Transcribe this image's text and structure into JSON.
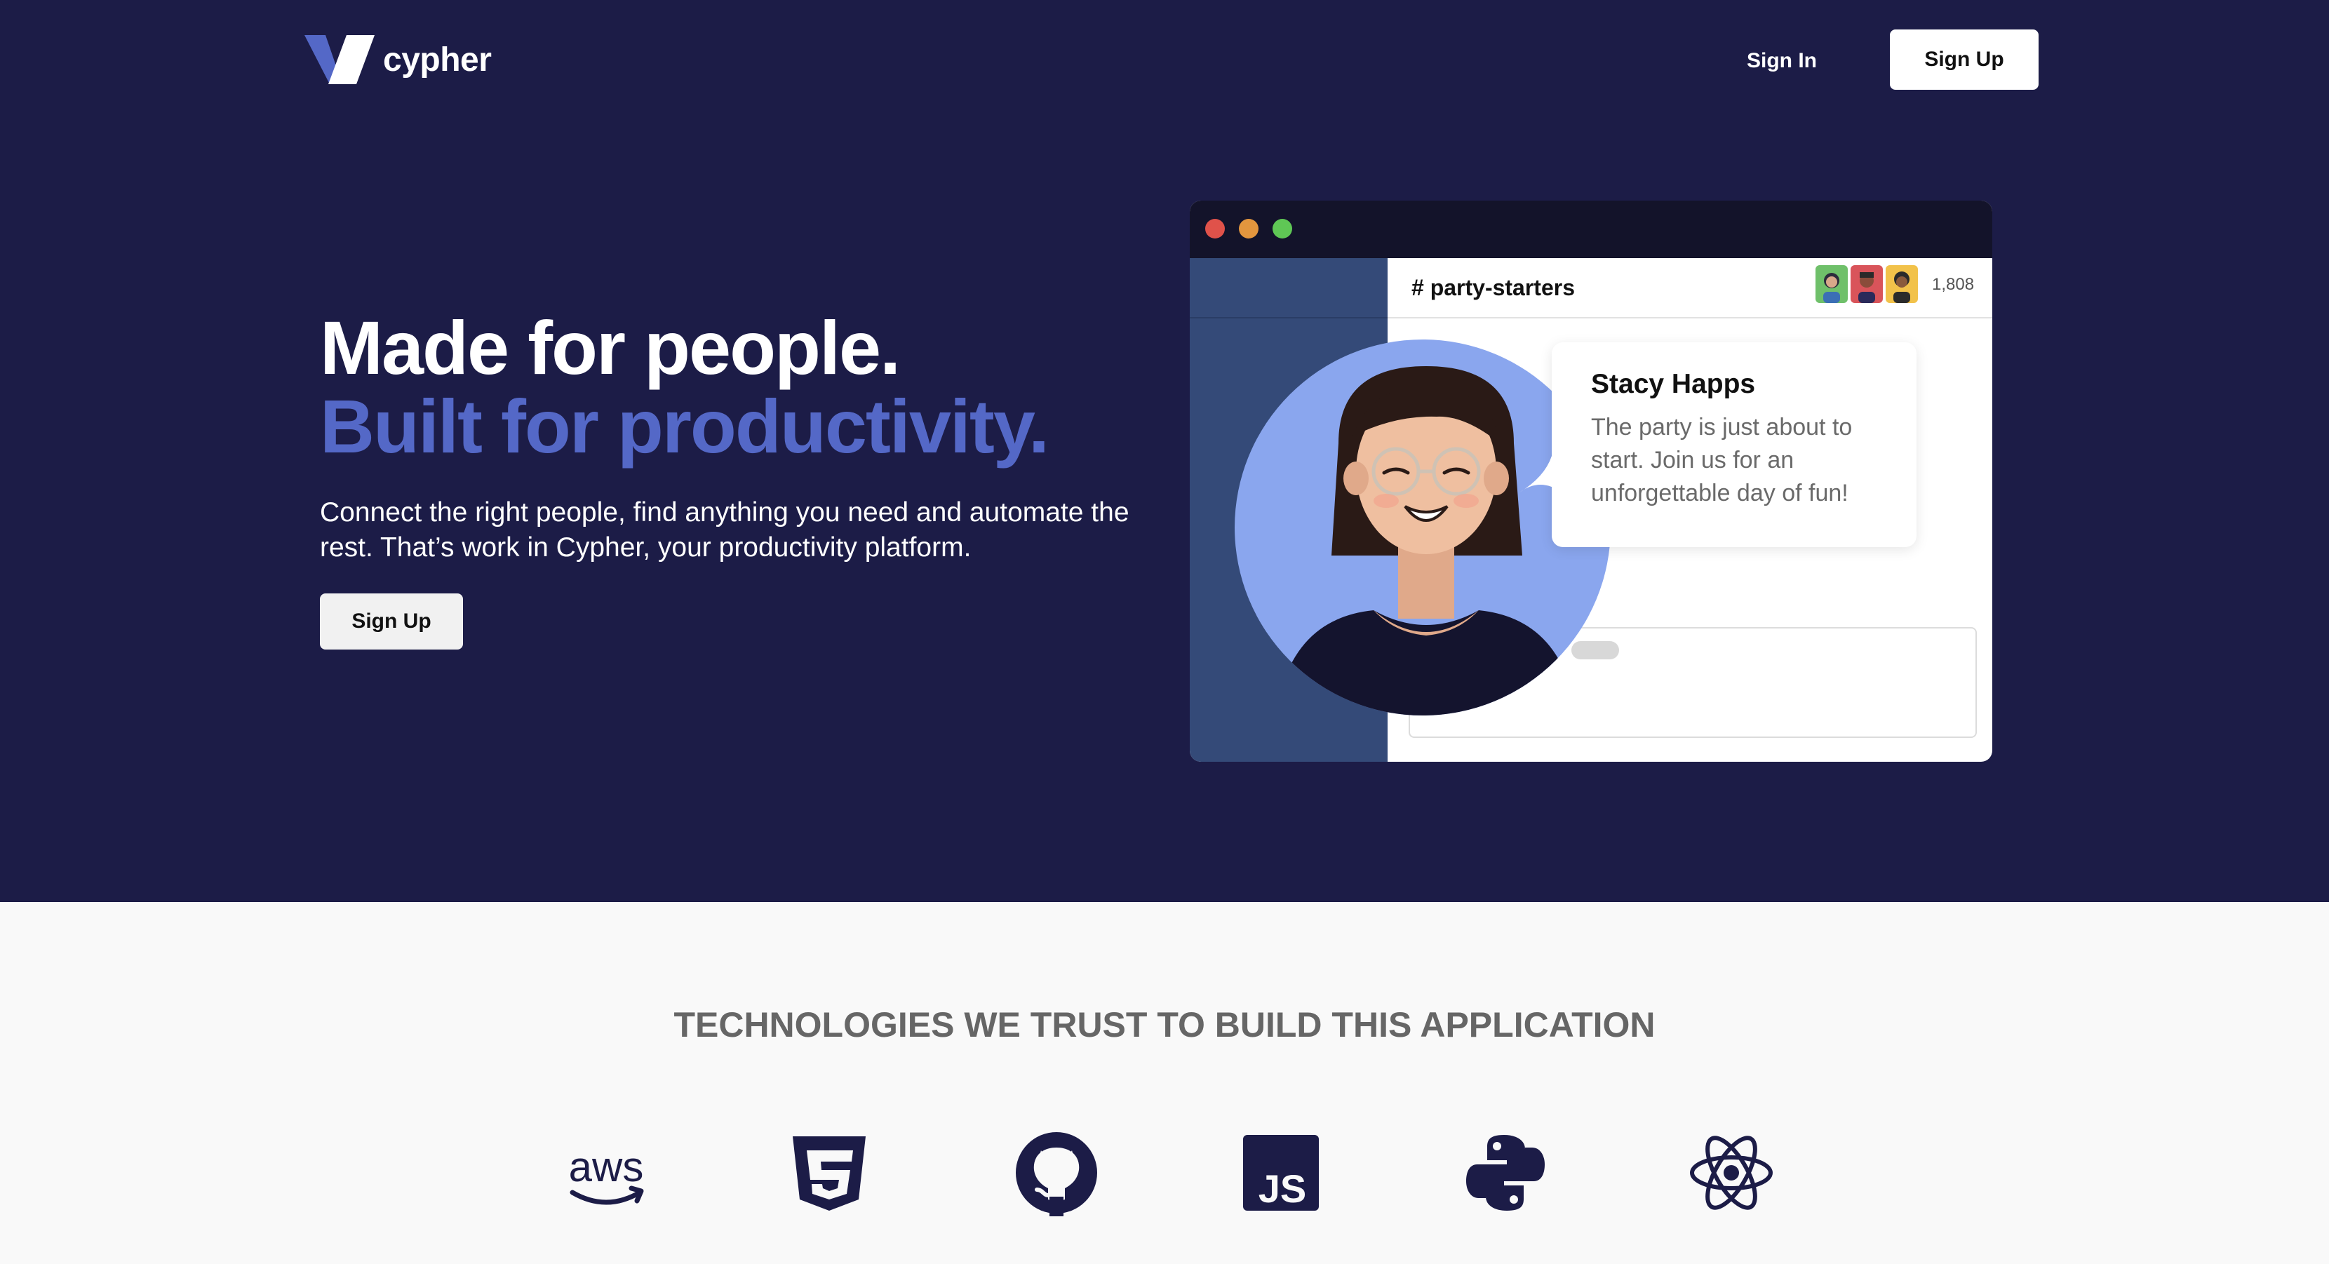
{
  "header": {
    "logo_text": "cypher",
    "sign_in": "Sign In",
    "sign_up": "Sign Up"
  },
  "hero": {
    "headline_line1": "Made for people.",
    "headline_line2": "Built for productivity.",
    "subtext": "Connect the right people, find anything you need and automate the rest. That’s work in Cypher, your productivity platform.",
    "cta": "Sign Up"
  },
  "chat_window": {
    "channel": "# party-starters",
    "member_count": "1,808",
    "message": {
      "author": "Stacy Happs",
      "text": "The party is just about to start. Join us for an unforgettable day of fun!"
    }
  },
  "technologies": {
    "title": "TECHNOLOGIES WE TRUST TO BUILD THIS APPLICATION",
    "icons": [
      "aws-icon",
      "css3-icon",
      "github-icon",
      "javascript-icon",
      "python-icon",
      "react-icon"
    ]
  },
  "colors": {
    "hero_bg": "#1c1c47",
    "accent": "#5468c7",
    "sidebar": "#344a78",
    "avatar_circle": "#8aa6ee"
  }
}
